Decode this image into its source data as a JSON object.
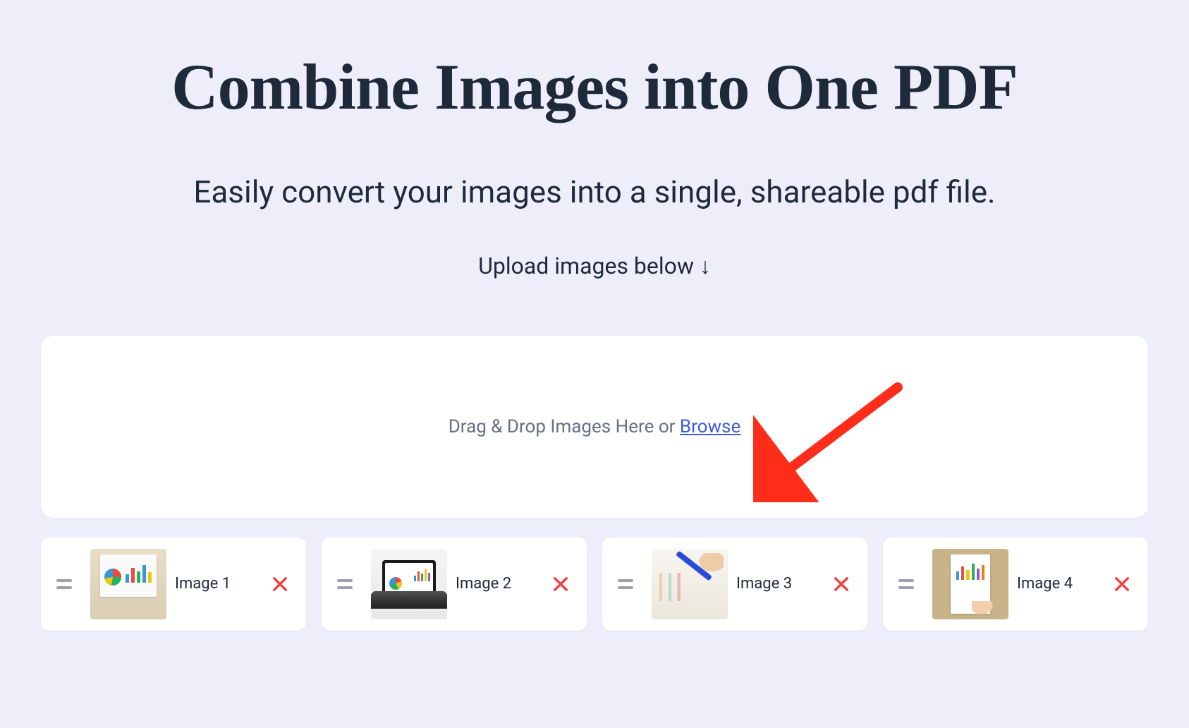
{
  "title": "Combine Images into One PDF",
  "subtitle": "Easily convert your images into a single, shareable pdf file.",
  "upload_hint": "Upload images below ↓",
  "dropzone": {
    "prefix": "Drag & Drop Images Here or  ",
    "browse": "Browse"
  },
  "thumbnails": [
    {
      "label": "Image 1"
    },
    {
      "label": "Image 2"
    },
    {
      "label": "Image 3"
    },
    {
      "label": "Image 4"
    }
  ]
}
